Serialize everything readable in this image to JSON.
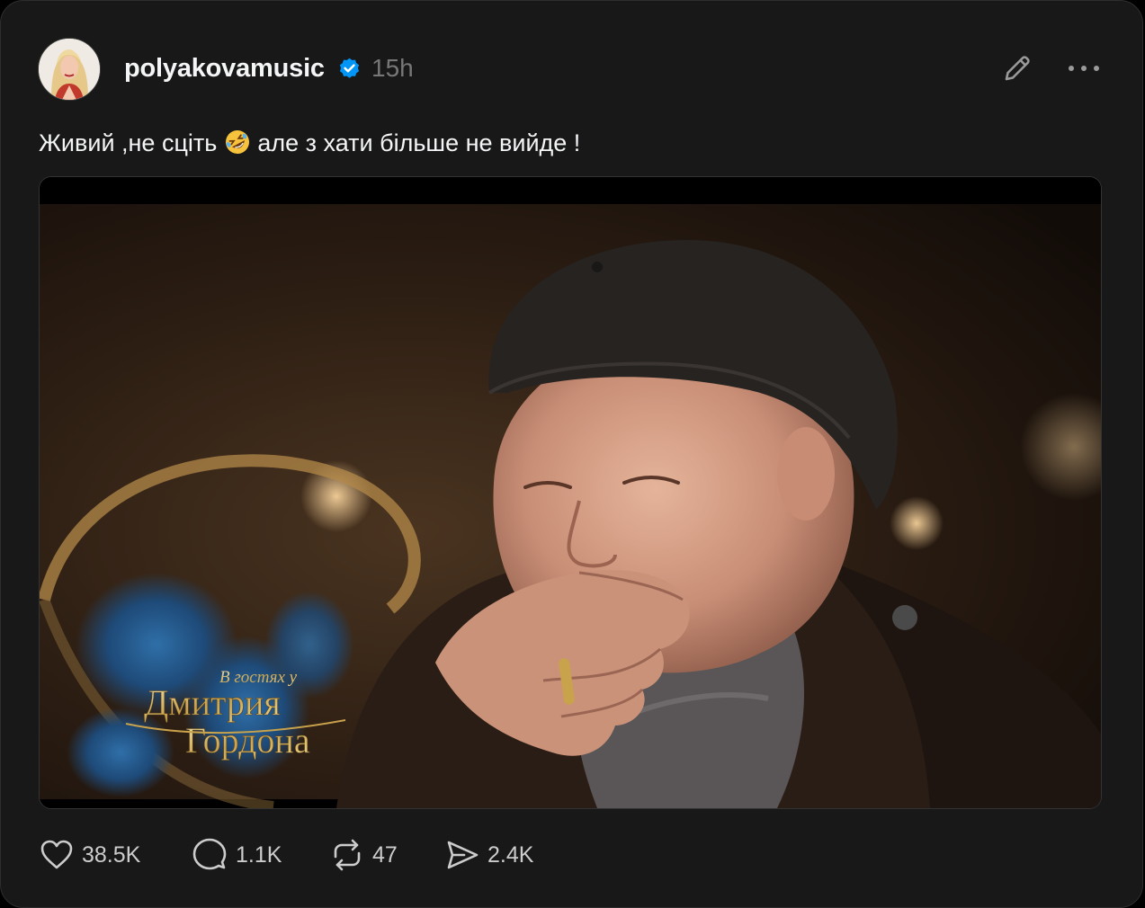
{
  "post": {
    "username": "polyakovamusic",
    "timestamp": "15h",
    "text_before": "Живий ,не сціть",
    "text_emoji": "rolling-on-floor-laughing-emoji",
    "text_after": "але з хати більше не вийде !"
  },
  "media": {
    "overlay_small": "В гостях у",
    "overlay_line1": "Дмитрия",
    "overlay_line2": "Гордона"
  },
  "actions": {
    "likes": "38.5K",
    "replies": "1.1K",
    "reposts": "47",
    "shares": "2.4K"
  },
  "icons": {
    "verified": "verified-badge-icon",
    "edit": "pencil-icon",
    "more": "more-icon",
    "like": "heart-icon",
    "reply": "comment-icon",
    "repost": "repost-icon",
    "share": "share-icon"
  },
  "colors": {
    "background": "#181818",
    "text": "#f3f5f7",
    "muted": "#777777",
    "verified": "#0095f6"
  }
}
